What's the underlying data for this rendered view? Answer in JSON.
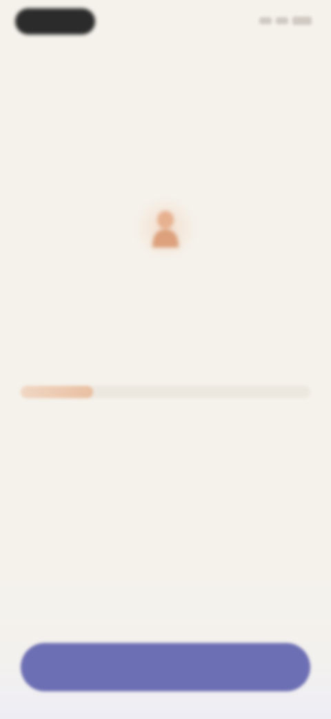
{
  "status_bar": {
    "pill_color": "#2b2b2b"
  },
  "header": {
    "back_label": "",
    "title": ""
  },
  "question": {
    "emoji_icon": "person-emoji-icon",
    "eyebrow": "",
    "text": ""
  },
  "slider": {
    "level_fraction": 0.25,
    "tick_count": 10,
    "ticks": [
      "",
      "",
      "",
      "",
      "",
      "",
      "",
      "",
      "",
      ""
    ],
    "fill_color": "#e9bfa1",
    "track_color": "#ece8df"
  },
  "cta": {
    "label": "",
    "color": "#6d6fb4"
  },
  "colors": {
    "background": "#f5f2eb",
    "accent": "#6d6fb4"
  }
}
